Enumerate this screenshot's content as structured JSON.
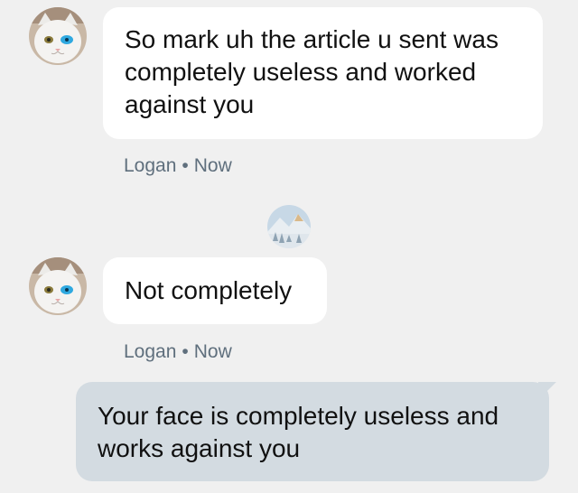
{
  "messages": [
    {
      "sender": "Logan",
      "direction": "incoming",
      "text": "So mark uh the article u sent was completely useless and worked against you",
      "time": "Now",
      "avatar_icon": "white-cat-avatar-icon"
    },
    {
      "sender": "Logan",
      "direction": "incoming",
      "text": "Not completely",
      "time": "Now",
      "avatar_icon": "white-cat-avatar-icon"
    },
    {
      "direction": "outgoing",
      "text": "Your face is completely useless and works against you"
    }
  ],
  "meta_separator": "•",
  "read_receipt_icon": "snowy-forest-avatar-icon",
  "colors": {
    "background": "#f0f0f0",
    "incoming_bubble": "#ffffff",
    "outgoing_bubble": "#d3dbe1",
    "meta_text": "#5f6f7d"
  }
}
